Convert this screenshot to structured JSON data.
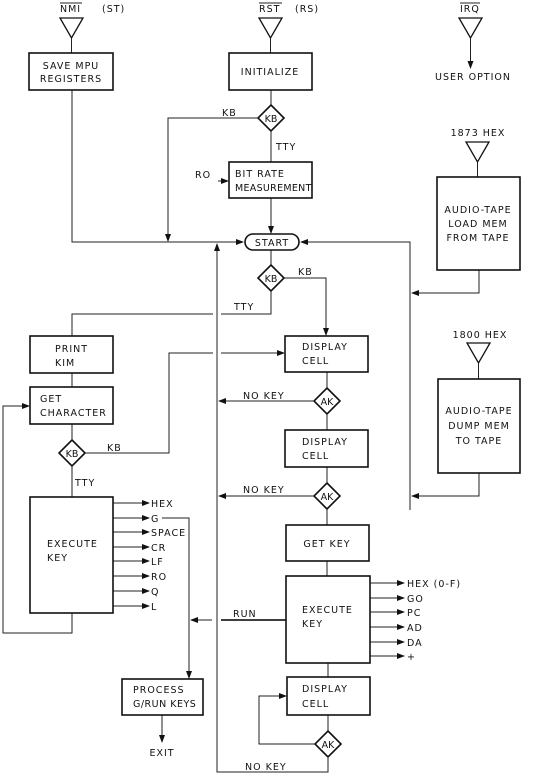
{
  "entry_points": {
    "nmi": {
      "label": "NMI",
      "note": "(ST)"
    },
    "rst": {
      "label": "RST",
      "note": "(RS)"
    },
    "irq": {
      "label": "IRQ",
      "target": "USER OPTION"
    },
    "load_tape": {
      "label": "1873 HEX"
    },
    "dump_tape": {
      "label": "1800 HEX"
    }
  },
  "nodes": {
    "save_mpu": [
      "SAVE MPU",
      "REGISTERS"
    ],
    "initialize": [
      "INITIALIZE"
    ],
    "bit_rate": [
      "BIT RATE",
      "MEASUREMENT"
    ],
    "start": "START",
    "load_tape": [
      "AUDIO-TAPE",
      "LOAD MEM",
      "FROM TAPE"
    ],
    "dump_tape": [
      "AUDIO-TAPE",
      "DUMP MEM",
      "TO TAPE"
    ],
    "print_kim": [
      "PRINT",
      "KIM"
    ],
    "get_char": [
      "GET",
      "CHARACTER"
    ],
    "execute_key_tty": [
      "EXECUTE",
      "KEY"
    ],
    "process_g_run": [
      "PROCESS",
      "G/RUN KEYS"
    ],
    "exit": "EXIT",
    "display_cell_1": [
      "DISPLAY",
      "CELL"
    ],
    "display_cell_2": [
      "DISPLAY",
      "CELL"
    ],
    "get_key": [
      "GET KEY"
    ],
    "execute_key_kb": [
      "EXECUTE",
      "KEY"
    ],
    "display_cell_3": [
      "DISPLAY",
      "CELL"
    ]
  },
  "decisions": {
    "kb": "KB",
    "ak": "AK"
  },
  "edge_labels": {
    "kb": "KB",
    "tty": "TTY",
    "ro": "RO",
    "no_key": "NO KEY",
    "run": "RUN"
  },
  "tty_keys": [
    "HEX",
    "G",
    "SPACE",
    "CR",
    "LF",
    "RO",
    "Q",
    "L"
  ],
  "kb_keys": [
    "HEX (0-F)",
    "GO",
    "PC",
    "AD",
    "DA",
    "+"
  ]
}
